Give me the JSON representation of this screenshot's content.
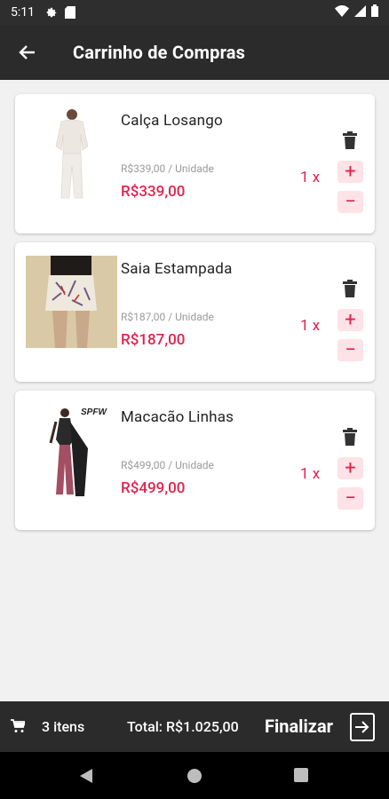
{
  "status_bar": {
    "time": "5:11"
  },
  "app_bar": {
    "title": "Carrinho de Compras"
  },
  "cart": {
    "items": [
      {
        "name": "Calça Losango",
        "unit_price_text": "R$339,00 / Unidade",
        "price": "R$339,00",
        "quantity": "1 x"
      },
      {
        "name": "Saia Estampada",
        "unit_price_text": "R$187,00 / Unidade",
        "price": "R$187,00",
        "quantity": "1 x"
      },
      {
        "name": "Macacão Linhas",
        "unit_price_text": "R$499,00 / Unidade",
        "price": "R$499,00",
        "quantity": "1 x"
      }
    ],
    "plus_label": "+",
    "minus_label": "−"
  },
  "footer": {
    "items_count": "3 itens",
    "total": "Total: R$1.025,00",
    "finish_label": "Finalizar"
  },
  "colors": {
    "accent": "#e1224c",
    "bar": "#2b2b2b"
  }
}
